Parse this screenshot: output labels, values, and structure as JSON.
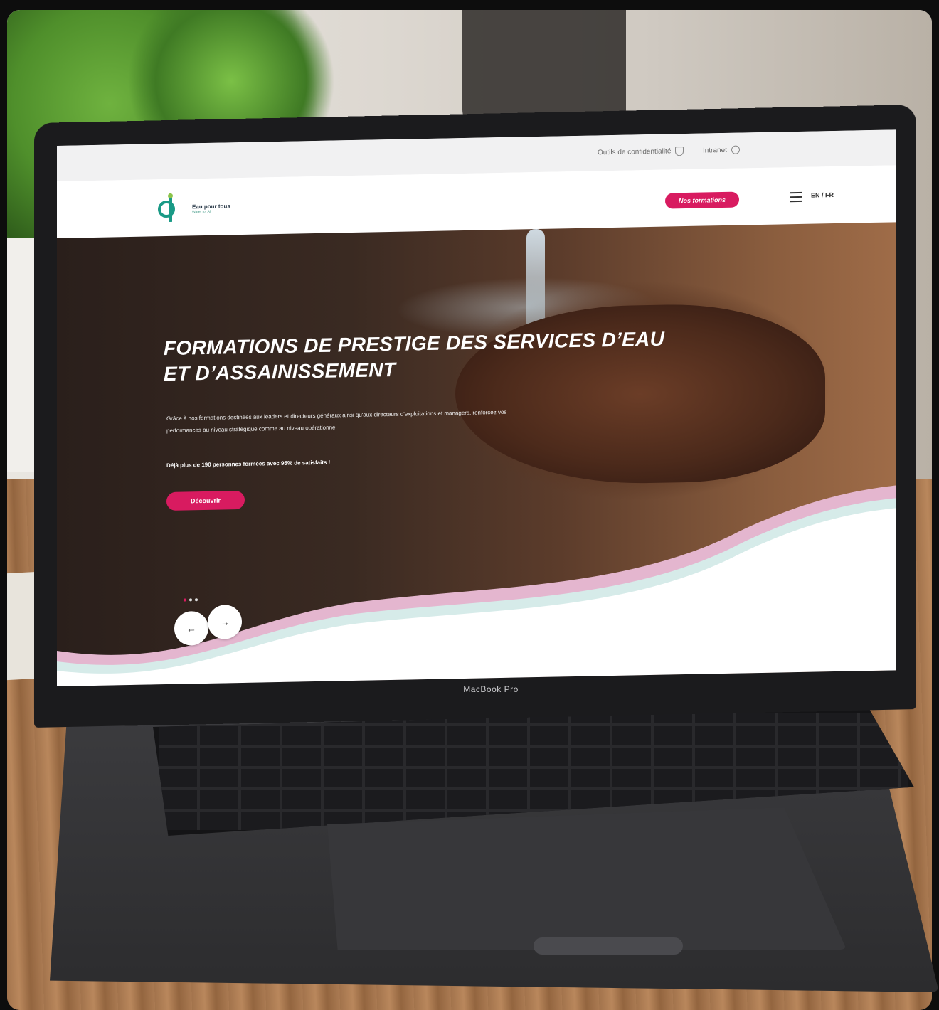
{
  "topbar": {
    "privacy_label": "Outils de confidentialité",
    "intranet_label": "Intranet"
  },
  "header": {
    "logo_line1": "Eau pour tous",
    "logo_line2": "Water for All",
    "cta_label": "Nos formations",
    "lang_label": "EN / FR"
  },
  "hero": {
    "title": "FORMATIONS DE PRESTIGE DES SERVICES D’EAU ET D’ASSAINISSEMENT",
    "description": "Grâce à nos formations destinées aux leaders et directeurs généraux ainsi qu'aux directeurs d'exploitations et managers, renforcez vos performances au niveau stratégique comme au niveau opérationnel !",
    "stat": "Déjà plus de 190 personnes formées avec 95% de satisfaits !",
    "cta_label": "Découvrir",
    "prev_arrow": "←",
    "next_arrow": "→"
  },
  "device": {
    "label": "MacBook Pro"
  },
  "colors": {
    "accent": "#d81b60",
    "brand_teal": "#1a9a86",
    "wave_pink": "#e4b6cf",
    "wave_mint": "#d6ebe9"
  }
}
